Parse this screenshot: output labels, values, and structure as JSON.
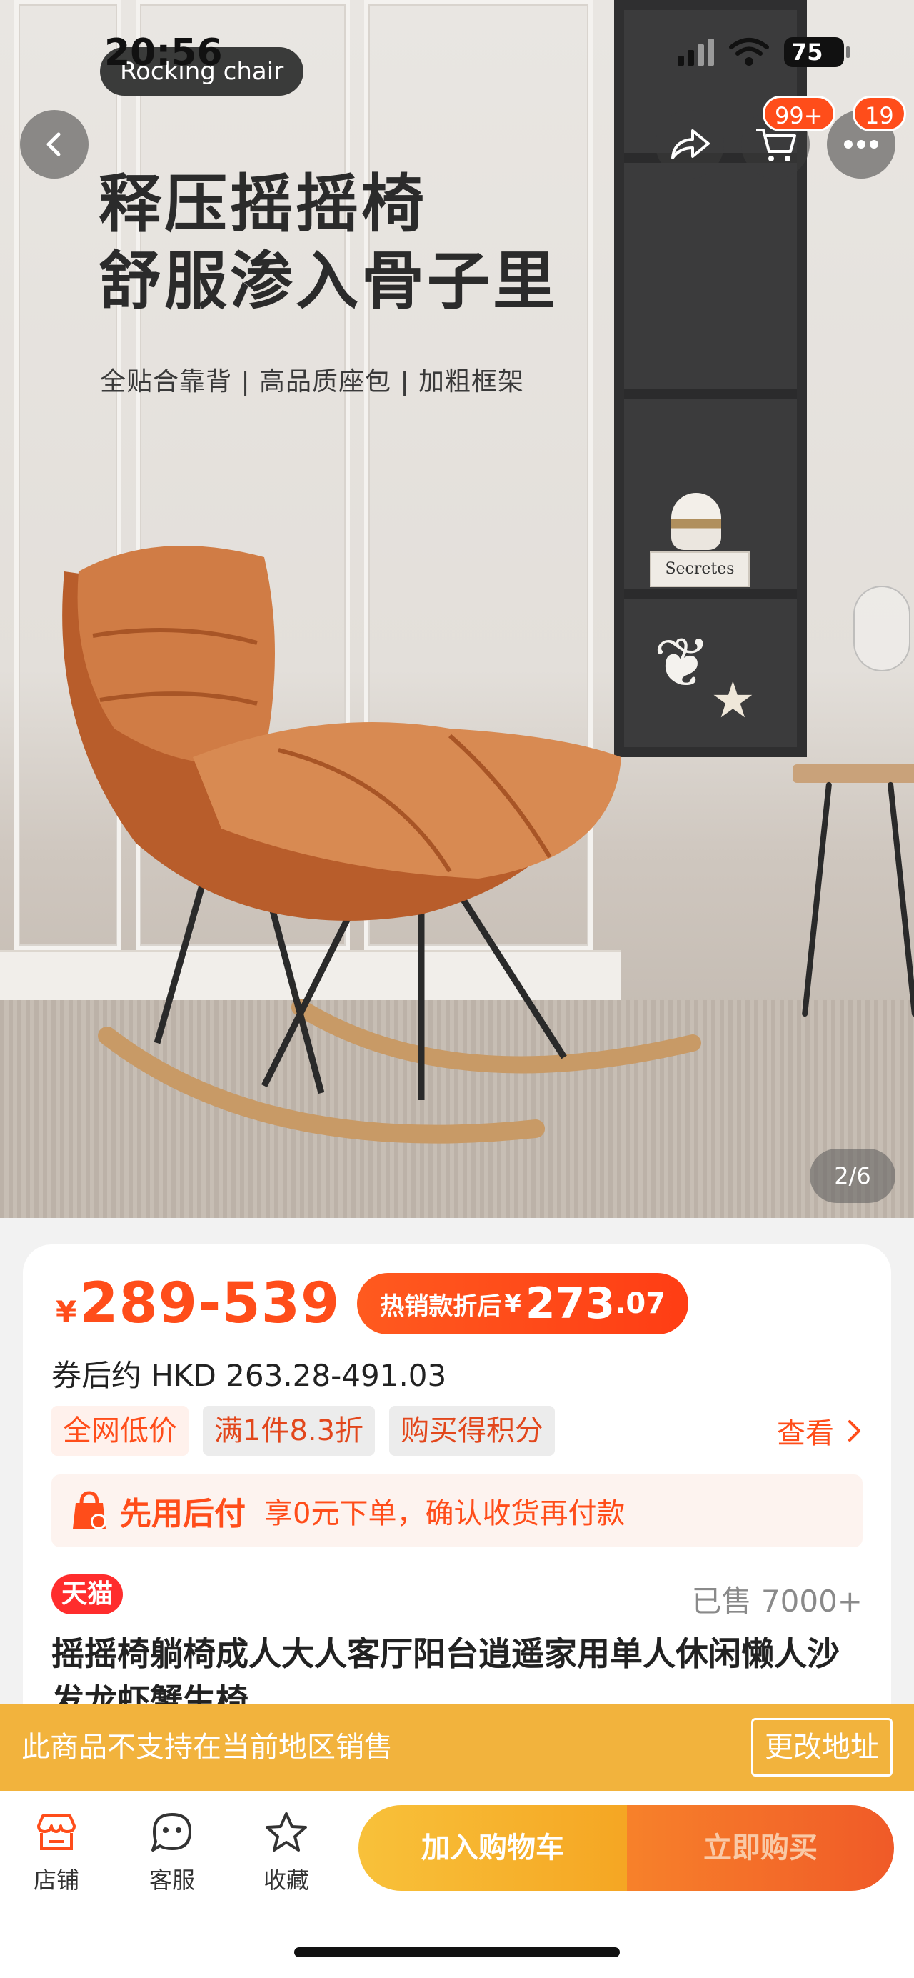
{
  "status_bar": {
    "time": "20:56",
    "battery": "75"
  },
  "hero": {
    "brand_pill": "Rocking chair",
    "headline_line1": "释压摇摇椅",
    "headline_line2": "舒服渗入骨子里",
    "subline": "全贴合靠背 | 高品质座包 | 加粗框架",
    "books_label": "Secretes",
    "page_indicator": "2/6"
  },
  "nav": {
    "cart_badge": "99+",
    "more_badge": "19",
    "icons": [
      "back-icon",
      "share-icon",
      "cart-icon",
      "more-icon"
    ]
  },
  "product": {
    "currency": "¥",
    "price_range": "289-539",
    "hot_label": "热销款折后",
    "hot_currency": "¥",
    "hot_price_int": "273",
    "hot_price_dec": ".07",
    "coupon_line": "券后约 HKD 263.28-491.03",
    "tags": [
      "全网低价",
      "满1件8.3折",
      "购买得积分"
    ],
    "see_more": "查看",
    "paylater_title": "先用后付",
    "paylater_desc": "享0元下单，确认收货再付款",
    "store_badge": "天猫",
    "sold": "已售 7000+",
    "title": "摇摇椅躺椅成人大人客厅阳台逍遥家用单人休闲懒人沙发龙虾蟹生椅"
  },
  "region_banner": {
    "message": "此商品不支持在当前地区销售",
    "change_label": "更改地址"
  },
  "bottom_bar": {
    "store": "店铺",
    "service": "客服",
    "favorite": "收藏",
    "add_to_cart": "加入购物车",
    "buy_now": "立即购买"
  },
  "colors": {
    "accent": "#ff4d1a",
    "banner": "#f2b33d",
    "cart_button": "#f5a623",
    "buy_button": "#f05a28"
  }
}
